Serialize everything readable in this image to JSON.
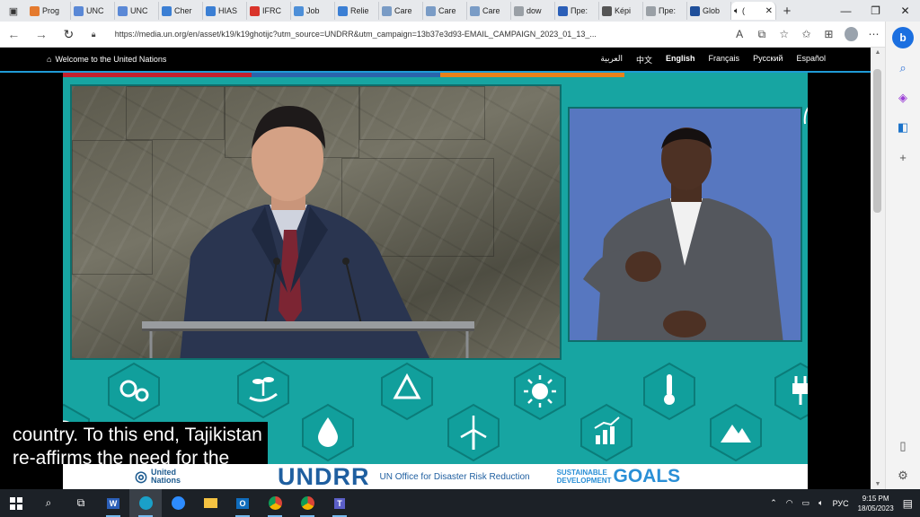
{
  "browser": {
    "tabs": [
      {
        "label": "Prog",
        "icon": "orange-app-icon",
        "color": "#e47a2e"
      },
      {
        "label": "UNC",
        "icon": "un-icon",
        "color": "#5a88d6"
      },
      {
        "label": "UNC",
        "icon": "un-icon",
        "color": "#5a88d6"
      },
      {
        "label": "Cher",
        "icon": "grid-icon",
        "color": "#3b7fd4"
      },
      {
        "label": "HIAS",
        "icon": "grid-icon",
        "color": "#3b7fd4"
      },
      {
        "label": "IFRC",
        "icon": "red-cross-icon",
        "color": "#d9342b"
      },
      {
        "label": "Job",
        "icon": "gear-icon",
        "color": "#4d8fd8"
      },
      {
        "label": "Relie",
        "icon": "grid-icon",
        "color": "#3b7fd4"
      },
      {
        "label": "Care",
        "icon": "w-icon",
        "color": "#7a9cc6"
      },
      {
        "label": "Care",
        "icon": "w-icon",
        "color": "#7a9cc6"
      },
      {
        "label": "Care",
        "icon": "w-icon",
        "color": "#7a9cc6"
      },
      {
        "label": "dow",
        "icon": "document-icon",
        "color": "#9aa0a6"
      },
      {
        "label": "Пре:",
        "icon": "search-icon",
        "color": "#2b5fb8"
      },
      {
        "label": "Képi",
        "icon": "wikipedia-icon",
        "color": "#555555"
      },
      {
        "label": "Пре:",
        "icon": "document-icon",
        "color": "#9aa0a6"
      },
      {
        "label": "Glob",
        "icon": "un-icon",
        "color": "#1f4f9a"
      }
    ],
    "active_tab": {
      "label": "(",
      "icon": "speaker-icon"
    },
    "new_tab": "+",
    "window_controls": {
      "minimize": "—",
      "maximize": "❐",
      "close": "✕"
    },
    "url": "https://media.un.org/en/asset/k19/k19ghotijc?utm_source=UNDRR&utm_campaign=13b37e3d93-EMAIL_CAMPAIGN_2023_01_13_..."
  },
  "un_nav": {
    "welcome": "Welcome to the United Nations",
    "languages": [
      "العربية",
      "中文",
      "English",
      "Français",
      "Русский",
      "Español"
    ],
    "active_language": "English"
  },
  "colors": {
    "stage_teal": "#17a5a2",
    "sign_blue": "#5777c0",
    "undrr_blue": "#1f5fa0",
    "sdg_blue": "#2a8fd6",
    "top_bars": [
      "#c3202f",
      "#a0286e",
      "#2a64ac",
      "#e8821b"
    ]
  },
  "caption": {
    "line1": "country. To this end, Tajikistan",
    "line2": "re-affirms the need for the"
  },
  "footer": {
    "un_logo_line1": "United",
    "un_logo_line2": "Nations",
    "undrr": "UNDRR",
    "undrr_subtitle": "UN Office for Disaster Risk Reduction",
    "sdg_line1": "SUSTAINABLE",
    "sdg_line2": "DEVELOPMENT",
    "sdg_goals": "GOALS"
  },
  "sdg_icons": [
    "gears-icon",
    "plant-hand-icon",
    "recycle-icon",
    "sun-icon",
    "thermometer-icon",
    "plug-icon",
    "globe-icon",
    "water-drop-icon",
    "wind-turbine-icon",
    "bar-chart-icon",
    "mountain-icon"
  ],
  "taskbar": {
    "apps": [
      "search-icon",
      "task-view-icon",
      "word-icon",
      "edge-icon",
      "zoom-icon",
      "file-explorer-icon",
      "outlook-icon",
      "chrome-icon",
      "chrome-icon",
      "teams-icon"
    ],
    "language": "РУС",
    "time": "9:15 PM",
    "date": "18/05/2023"
  }
}
